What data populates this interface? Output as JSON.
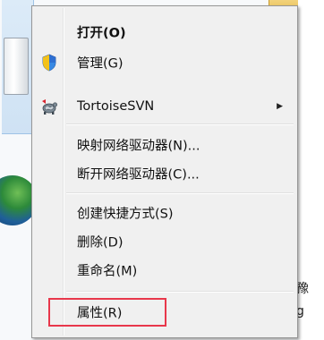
{
  "menu": {
    "items": [
      {
        "label": "打开(O)",
        "bold": true
      },
      {
        "label": "管理(G)",
        "icon": "uac-shield-icon"
      },
      {
        "label": "TortoiseSVN",
        "icon": "tortoisesvn-icon",
        "submenu_arrow": "▶"
      },
      {
        "label": "映射网络驱动器(N)..."
      },
      {
        "label": "断开网络驱动器(C)..."
      },
      {
        "label": "创建快捷方式(S)"
      },
      {
        "label": "删除(D)"
      },
      {
        "label": "重命名(M)"
      },
      {
        "label": "属性(R)"
      }
    ]
  },
  "background": {
    "right_text_1": "豫",
    "right_text_2": "g"
  },
  "colors": {
    "menu_bg": "#f0f0f0",
    "highlight": "#e8374b"
  }
}
